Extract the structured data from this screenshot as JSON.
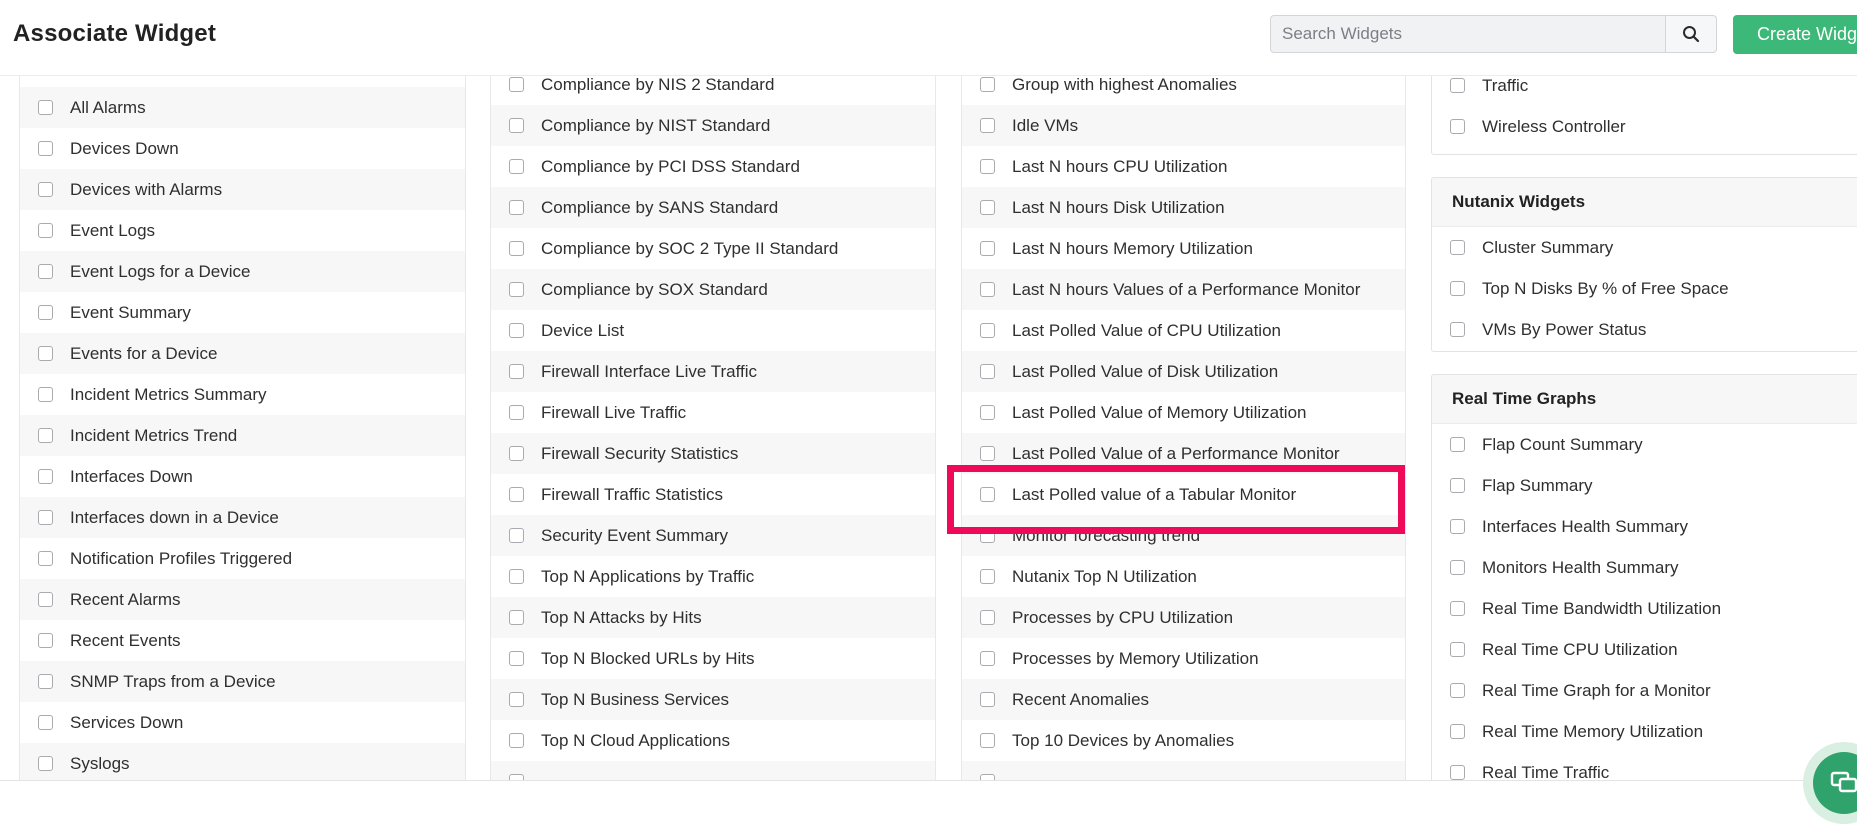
{
  "header": {
    "title": "Associate Widget",
    "search_placeholder": "Search Widgets",
    "search_icon": "search-icon",
    "create_label": "Create Widget"
  },
  "columns": {
    "col1": {
      "items": [
        {
          "label": ""
        },
        {
          "label": "All Alarms"
        },
        {
          "label": "Devices Down"
        },
        {
          "label": "Devices with Alarms"
        },
        {
          "label": "Event Logs"
        },
        {
          "label": "Event Logs for a Device"
        },
        {
          "label": "Event Summary"
        },
        {
          "label": "Events for a Device"
        },
        {
          "label": "Incident Metrics Summary"
        },
        {
          "label": "Incident Metrics Trend"
        },
        {
          "label": "Interfaces Down"
        },
        {
          "label": "Interfaces down in a Device"
        },
        {
          "label": "Notification Profiles Triggered"
        },
        {
          "label": "Recent Alarms"
        },
        {
          "label": "Recent Events"
        },
        {
          "label": "SNMP Traps from a Device"
        },
        {
          "label": "Services Down"
        },
        {
          "label": "Syslogs"
        }
      ]
    },
    "col2": {
      "items": [
        {
          "label": "Compliance by NIS 2 Standard"
        },
        {
          "label": "Compliance by NIST Standard"
        },
        {
          "label": "Compliance by PCI DSS Standard"
        },
        {
          "label": "Compliance by SANS Standard"
        },
        {
          "label": "Compliance by SOC 2 Type II Standard"
        },
        {
          "label": "Compliance by SOX Standard"
        },
        {
          "label": "Device List"
        },
        {
          "label": "Firewall Interface Live Traffic"
        },
        {
          "label": "Firewall Live Traffic"
        },
        {
          "label": "Firewall Security Statistics"
        },
        {
          "label": "Firewall Traffic Statistics"
        },
        {
          "label": "Security Event Summary"
        },
        {
          "label": "Top N Applications by Traffic"
        },
        {
          "label": "Top N Attacks by Hits"
        },
        {
          "label": "Top N Blocked URLs by Hits"
        },
        {
          "label": "Top N Business Services"
        },
        {
          "label": "Top N Cloud Applications"
        },
        {
          "label": ""
        }
      ]
    },
    "col3": {
      "items": [
        {
          "label": "Group with highest Anomalies"
        },
        {
          "label": "Idle VMs"
        },
        {
          "label": "Last N hours CPU Utilization"
        },
        {
          "label": "Last N hours Disk Utilization"
        },
        {
          "label": "Last N hours Memory Utilization"
        },
        {
          "label": "Last N hours Values of a Performance Monitor"
        },
        {
          "label": "Last Polled Value of CPU Utilization"
        },
        {
          "label": "Last Polled Value of Disk Utilization"
        },
        {
          "label": "Last Polled Value of Memory Utilization"
        },
        {
          "label": "Last Polled Value of a Performance Monitor"
        },
        {
          "label": "Last Polled value of a Tabular Monitor"
        },
        {
          "label": "Monitor forecasting trend"
        },
        {
          "label": "Nutanix Top N Utilization"
        },
        {
          "label": "Processes by CPU Utilization"
        },
        {
          "label": "Processes by Memory Utilization"
        },
        {
          "label": "Recent Anomalies"
        },
        {
          "label": "Top 10 Devices by Anomalies"
        },
        {
          "label": ""
        }
      ]
    },
    "col4": {
      "top_items": [
        {
          "label": "Traffic"
        },
        {
          "label": "Wireless Controller"
        }
      ],
      "nutanix": {
        "title": "Nutanix Widgets",
        "items": [
          {
            "label": "Cluster Summary"
          },
          {
            "label": "Top N Disks By % of Free Space"
          },
          {
            "label": "VMs By Power Status"
          }
        ]
      },
      "realtime": {
        "title": "Real Time Graphs",
        "items": [
          {
            "label": "Flap Count Summary"
          },
          {
            "label": "Flap Summary"
          },
          {
            "label": "Interfaces Health Summary"
          },
          {
            "label": "Monitors Health Summary"
          },
          {
            "label": "Real Time Bandwidth Utilization"
          },
          {
            "label": "Real Time CPU Utilization"
          },
          {
            "label": "Real Time Graph for a Monitor"
          },
          {
            "label": "Real Time Memory Utilization"
          },
          {
            "label": "Real Time Traffic"
          }
        ]
      }
    }
  },
  "highlight": {
    "target": "Last Polled value of a Tabular Monitor",
    "color": "#ee0a58"
  },
  "colors": {
    "accent_green": "#3cb878",
    "chat_green": "#2fa36b"
  },
  "chat": {
    "icon": "chat-bubbles-icon"
  }
}
